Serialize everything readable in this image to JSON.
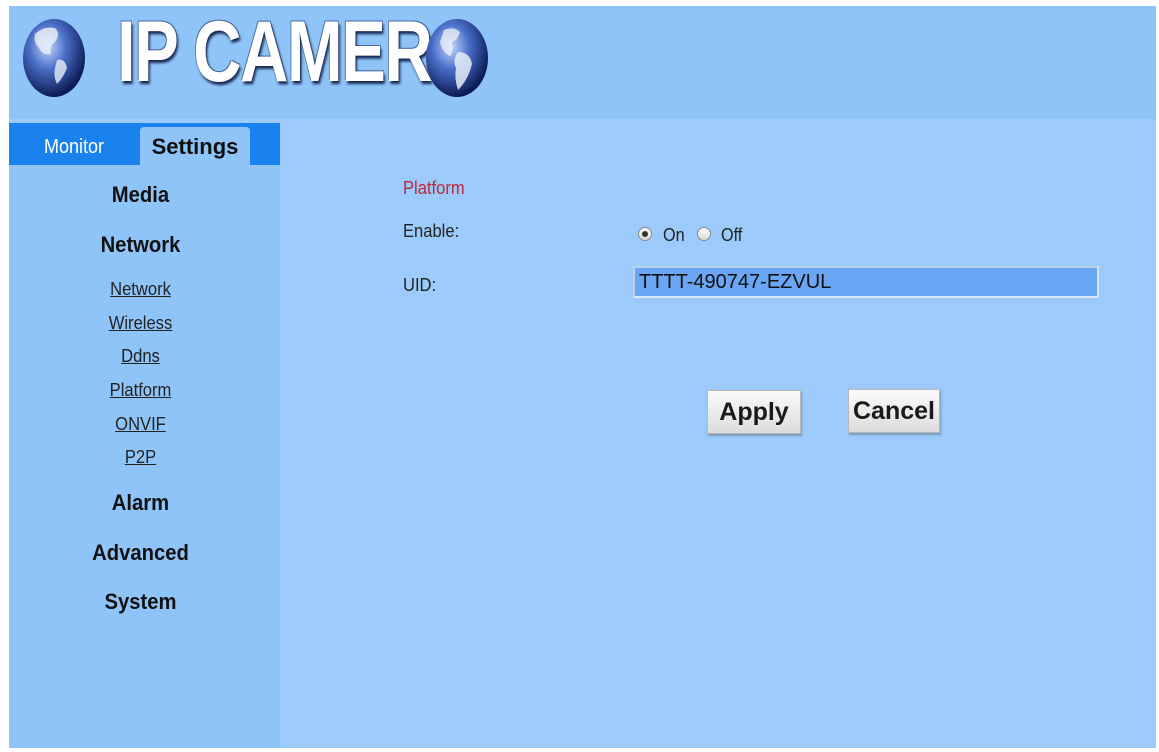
{
  "header": {
    "logo_text": "IP CAMERA",
    "left_icon": "globe-icon",
    "right_icon": "globe-icon"
  },
  "tabs": {
    "monitor": "Monitor",
    "settings": "Settings"
  },
  "sidebar": {
    "media": "Media",
    "network": "Network",
    "network_items": [
      "Network",
      "Wireless",
      "Ddns",
      "Platform",
      "ONVIF",
      "P2P"
    ],
    "alarm": "Alarm",
    "advanced": "Advanced",
    "system": "System"
  },
  "form": {
    "section_title": "Platform",
    "enable_label": "Enable:",
    "enable_options": [
      "On",
      "Off"
    ],
    "enable_value": "On",
    "uid_label": "UID:",
    "uid_value": "TTTT-490747-EZVUL",
    "apply_label": "Apply",
    "cancel_label": "Cancel"
  },
  "colors": {
    "tab_bar": "#1a82ee",
    "panel": "#9ccafa",
    "sidebar": "#8ec4f8",
    "section_title": "#c0263a",
    "input_bg": "#6aa6f4"
  }
}
